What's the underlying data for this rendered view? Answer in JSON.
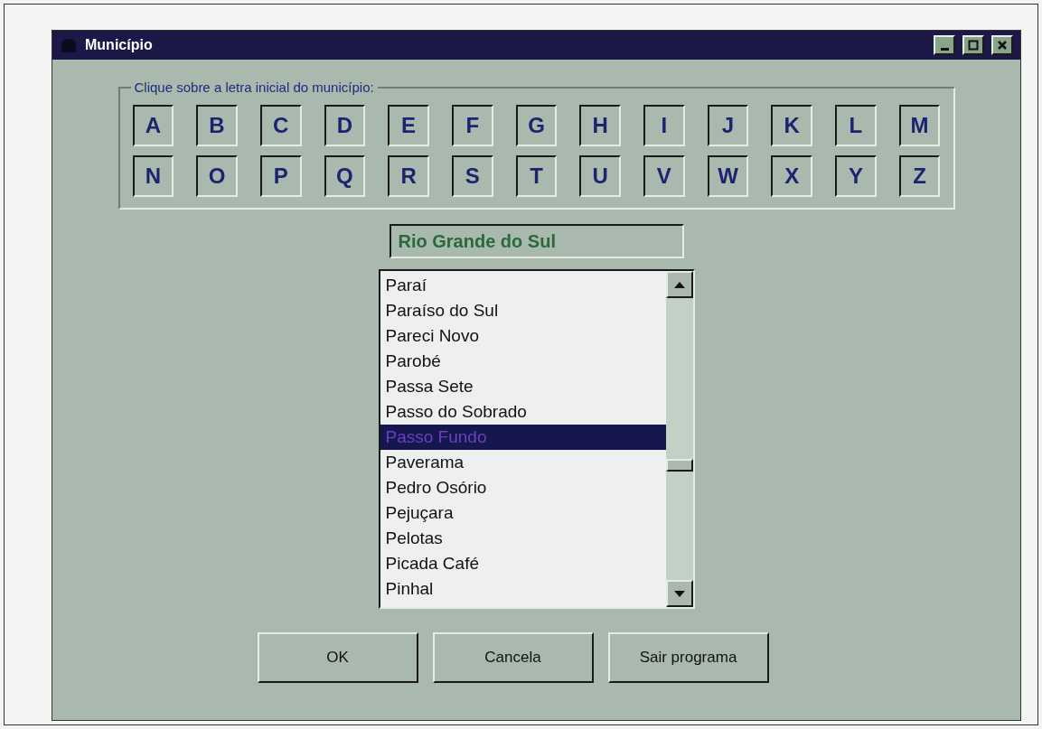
{
  "window": {
    "title": "Município"
  },
  "letters_group": {
    "legend": "Clique sobre a letra inicial do município:",
    "letters": [
      "A",
      "B",
      "C",
      "D",
      "E",
      "F",
      "G",
      "H",
      "I",
      "J",
      "K",
      "L",
      "M",
      "N",
      "O",
      "P",
      "Q",
      "R",
      "S",
      "T",
      "U",
      "V",
      "W",
      "X",
      "Y",
      "Z"
    ]
  },
  "state_field": {
    "value": "Rio Grande do Sul"
  },
  "municipalities": [
    {
      "name": "Paraí",
      "selected": false
    },
    {
      "name": "Paraíso do Sul",
      "selected": false
    },
    {
      "name": "Pareci Novo",
      "selected": false
    },
    {
      "name": "Parobé",
      "selected": false
    },
    {
      "name": "Passa Sete",
      "selected": false
    },
    {
      "name": "Passo do Sobrado",
      "selected": false
    },
    {
      "name": "Passo Fundo",
      "selected": true
    },
    {
      "name": "Paverama",
      "selected": false
    },
    {
      "name": "Pedro Osório",
      "selected": false
    },
    {
      "name": "Pejuçara",
      "selected": false
    },
    {
      "name": "Pelotas",
      "selected": false
    },
    {
      "name": "Picada Café",
      "selected": false
    },
    {
      "name": "Pinhal",
      "selected": false
    }
  ],
  "buttons": [
    "OK",
    "Cancela",
    "Sair programa"
  ]
}
